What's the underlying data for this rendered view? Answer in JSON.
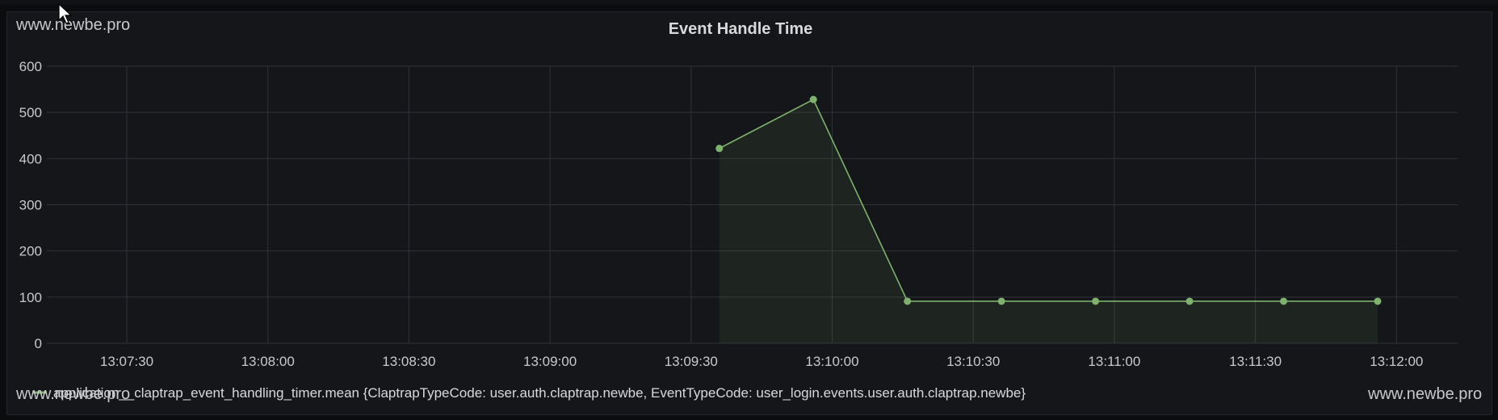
{
  "watermarks": {
    "top_left": "www.newbe.pro",
    "bottom_left": "www.newbe.pro",
    "bottom_right": "www.newbe.pro"
  },
  "chart_data": {
    "type": "line",
    "title": "Event Handle Time",
    "xlabel": "",
    "ylabel": "",
    "x_ticks": [
      "13:07:30",
      "13:08:00",
      "13:08:30",
      "13:09:00",
      "13:09:30",
      "13:10:00",
      "13:10:30",
      "13:11:00",
      "13:11:30",
      "13:12:00"
    ],
    "y_ticks": [
      0,
      100,
      200,
      300,
      400,
      500,
      600
    ],
    "xlim": [
      "13:07:13",
      "13:12:13"
    ],
    "ylim": [
      0,
      600
    ],
    "grid": true,
    "legend_position": "bottom-left",
    "series": [
      {
        "name": "application__claptrap_event_handling_timer.mean {ClaptrapTypeCode: user.auth.claptrap.newbe, EventTypeCode: user_login.events.user.auth.claptrap.newbe}",
        "color": "#7eb26d",
        "fill": true,
        "points": [
          {
            "x": "13:09:36",
            "y": 422
          },
          {
            "x": "13:09:56",
            "y": 528
          },
          {
            "x": "13:10:16",
            "y": 91
          },
          {
            "x": "13:10:36",
            "y": 91
          },
          {
            "x": "13:10:56",
            "y": 91
          },
          {
            "x": "13:11:16",
            "y": 91
          },
          {
            "x": "13:11:36",
            "y": 91
          },
          {
            "x": "13:11:56",
            "y": 91
          }
        ]
      }
    ]
  }
}
